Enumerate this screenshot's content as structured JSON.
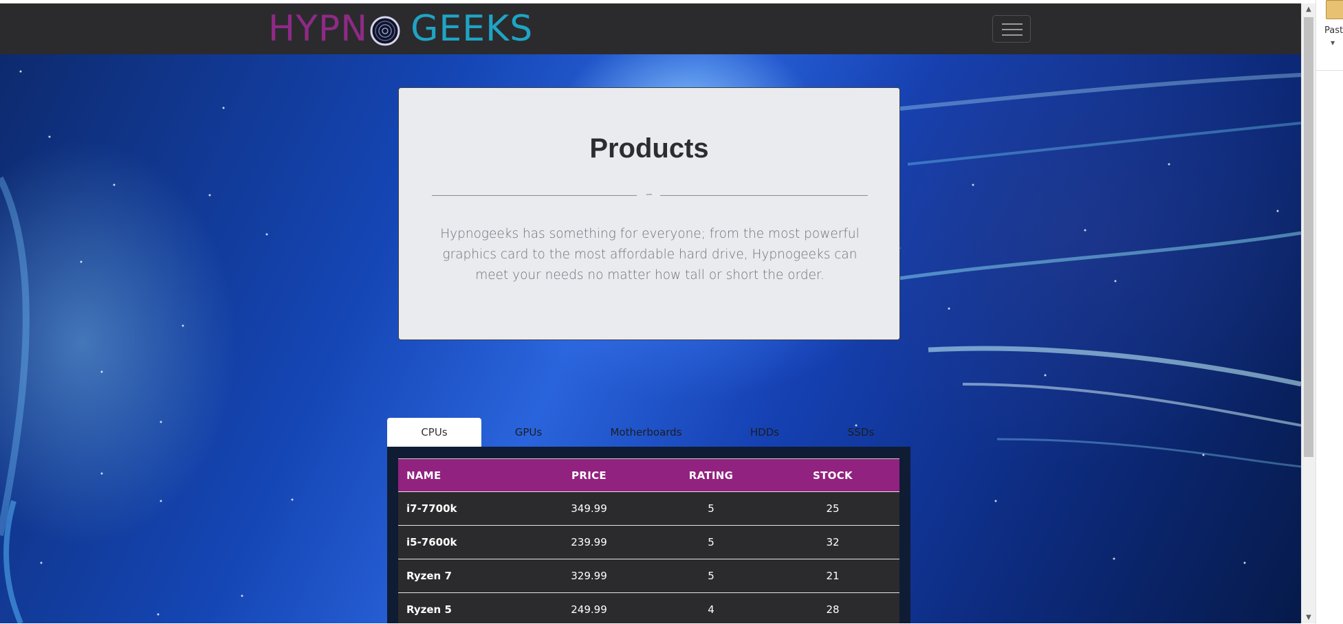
{
  "navbar": {
    "brand_part1": "HYPN",
    "brand_part2": "GEEKS",
    "colors": {
      "hypno": "#8e2a86",
      "geeks": "#1fa4c4",
      "background": "#2b2b2d"
    }
  },
  "hero": {
    "title": "Products",
    "text": "Hypnogeeks has something for everyone; from the most powerful graphics card to the most affordable hard drive, Hypnogeeks can meet your needs no matter how tall or short the order."
  },
  "tabs": [
    {
      "label": "CPUs",
      "active": true
    },
    {
      "label": "GPUs",
      "active": false
    },
    {
      "label": "Motherboards",
      "active": false
    },
    {
      "label": "HDDs",
      "active": false
    },
    {
      "label": "SSDs",
      "active": false
    }
  ],
  "table": {
    "headers": [
      "NAME",
      "PRICE",
      "RATING",
      "STOCK"
    ],
    "header_color": "#91227f",
    "rows": [
      {
        "name": "i7-7700k",
        "price": "349.99",
        "rating": "5",
        "stock": "25"
      },
      {
        "name": "i5-7600k",
        "price": "239.99",
        "rating": "5",
        "stock": "32"
      },
      {
        "name": "Ryzen 7",
        "price": "329.99",
        "rating": "5",
        "stock": "21"
      },
      {
        "name": "Ryzen 5",
        "price": "249.99",
        "rating": "4",
        "stock": "28"
      }
    ]
  },
  "side_panel": {
    "paste_label": "Past"
  },
  "icons": {
    "menu": "hamburger-menu-icon",
    "logo": "hypno-spiral-logo-icon",
    "divider": "flourish-icon",
    "scroll_up": "chevron-up-icon",
    "scroll_down": "chevron-down-icon",
    "paste": "clipboard-icon"
  }
}
